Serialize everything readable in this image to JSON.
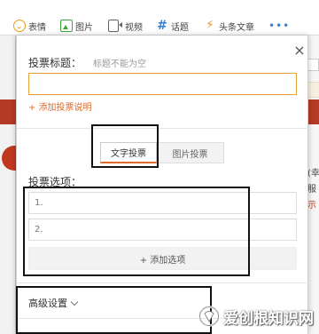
{
  "toolbar": {
    "items": [
      {
        "label": "表情",
        "icon": "smile-icon"
      },
      {
        "label": "图片",
        "icon": "image-icon"
      },
      {
        "label": "视频",
        "icon": "video-icon"
      },
      {
        "label": "话题",
        "icon": "hashtag-icon"
      },
      {
        "label": "头条文章",
        "icon": "lightning-icon"
      }
    ],
    "more": "•••"
  },
  "dialog": {
    "close": "×",
    "title_label": "投票标题：",
    "title_hint": "标题不能为空",
    "title_value": "",
    "add_description": "+ 添加投票说明",
    "tabs": [
      "文字投票",
      "图片投票"
    ],
    "options_label": "投票选项：",
    "options": [
      "1.",
      "2."
    ],
    "add_option": "+ 添加选项",
    "advanced_settings": "高级设置"
  },
  "background_fragments": [
    "(幸",
    "服",
    "示"
  ],
  "watermark": {
    "text": "爱创根知识网"
  },
  "colors": {
    "accent_orange": "#e06a2a",
    "input_focus_border": "#e8a23c",
    "background_red": "#b43a25",
    "annotation_box": "#111111"
  }
}
